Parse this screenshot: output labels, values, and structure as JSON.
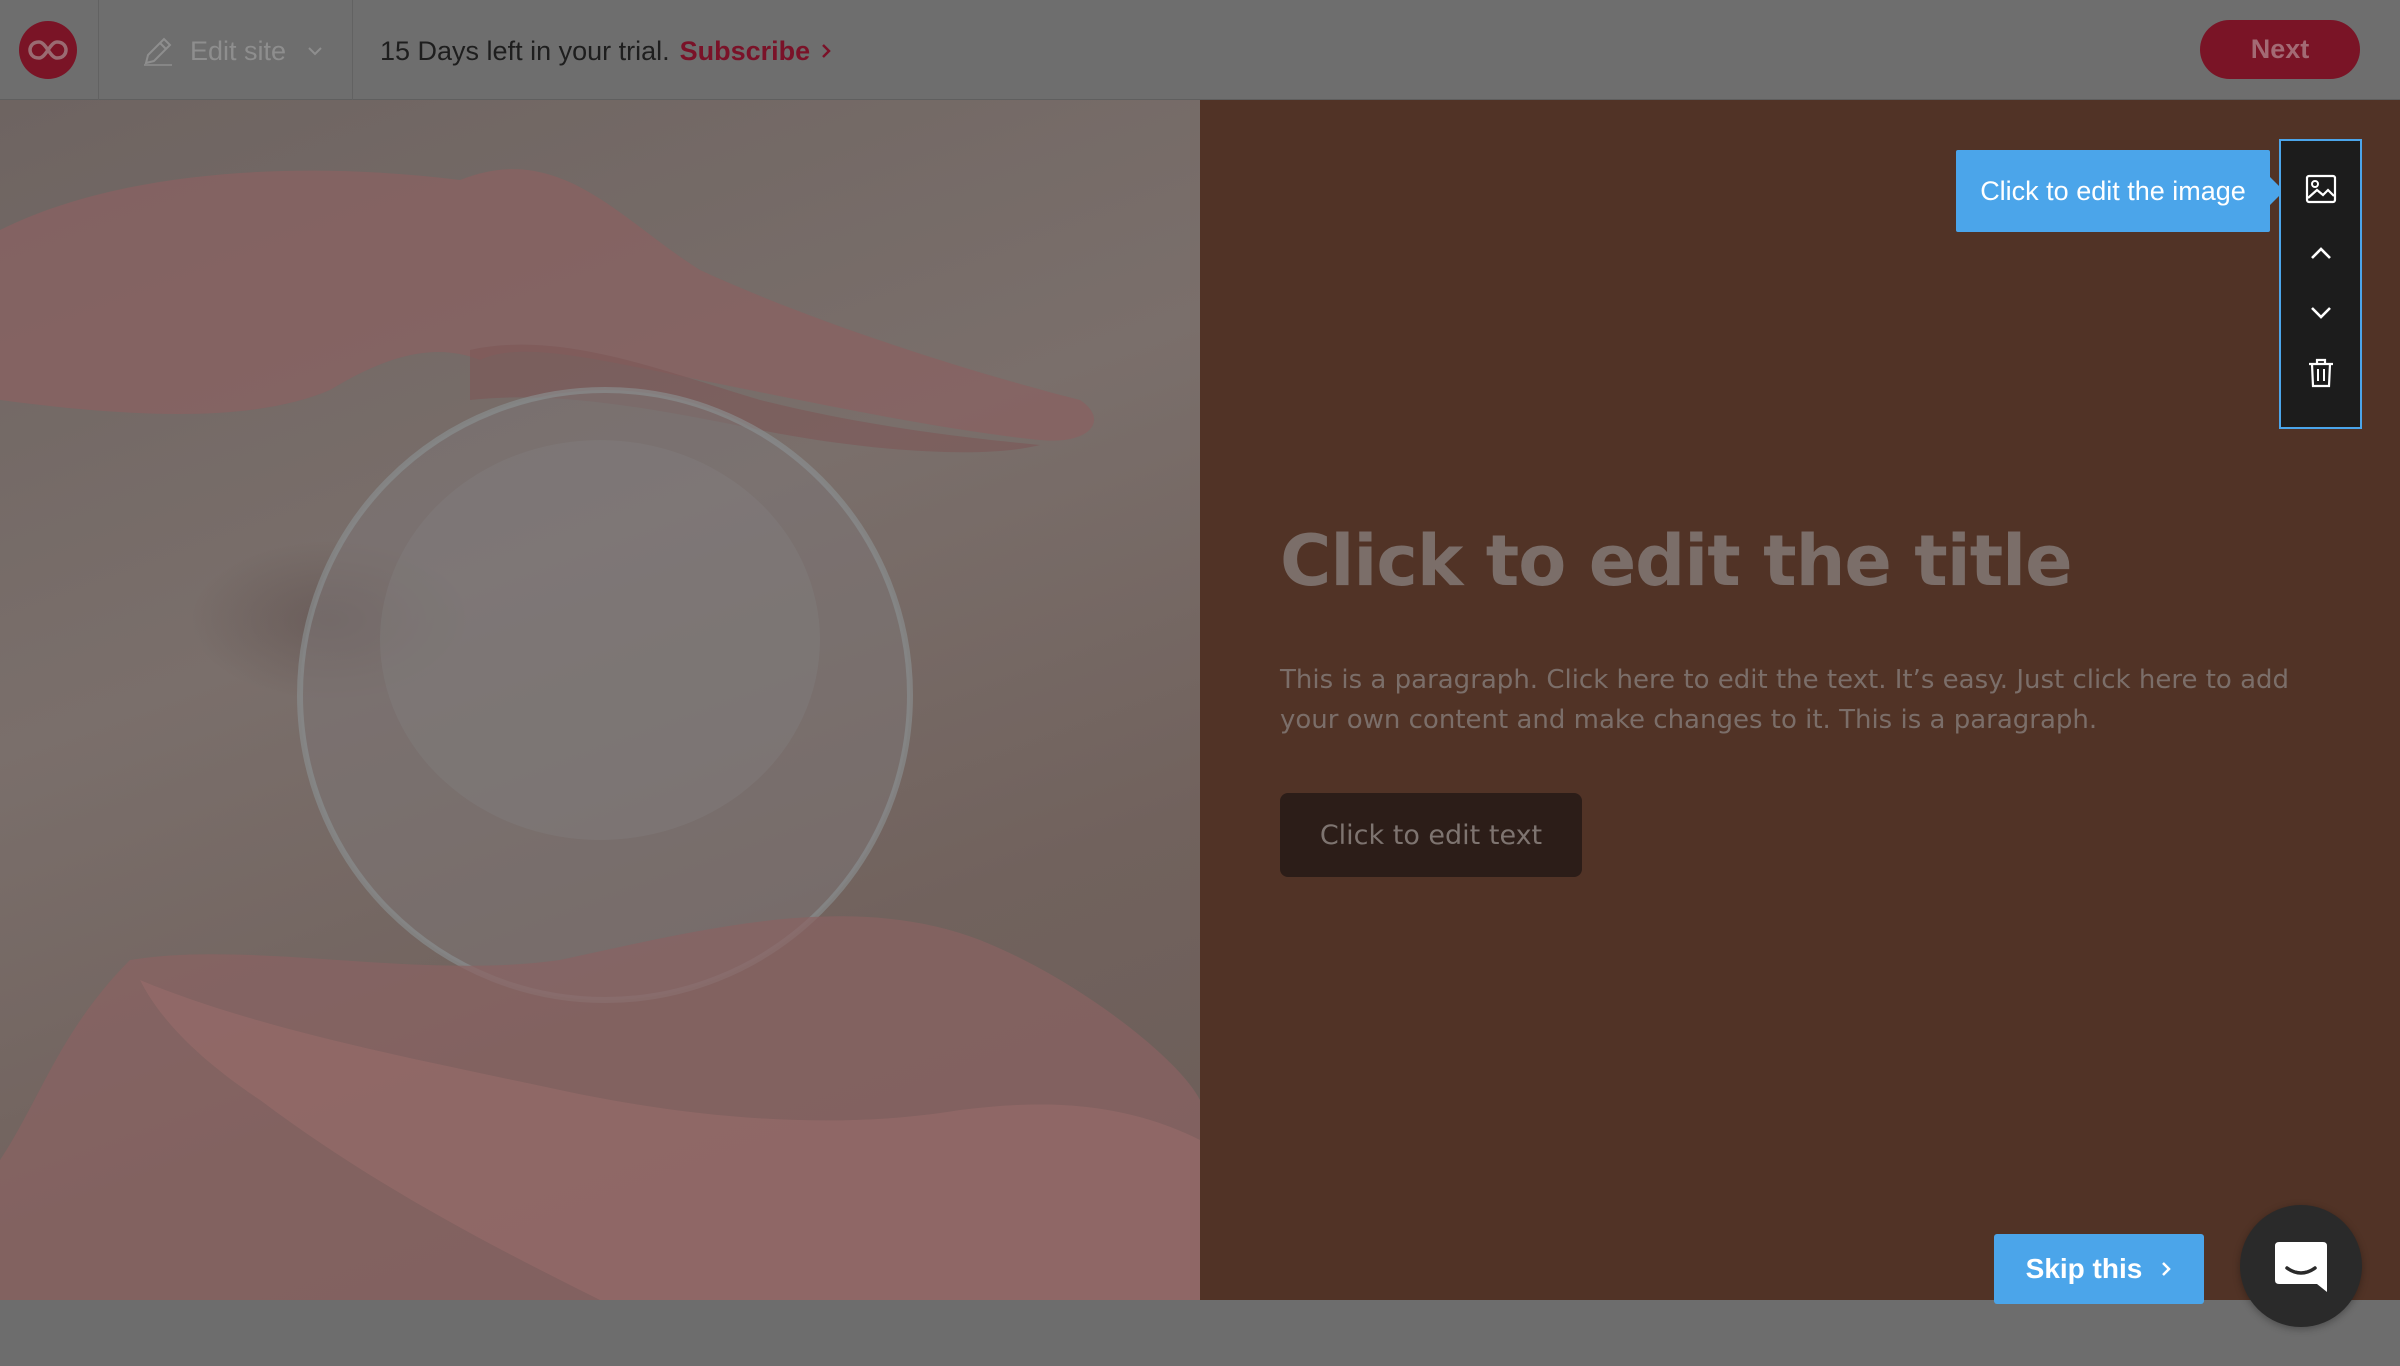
{
  "topbar": {
    "logo_icon": "infinity-logo-icon",
    "edit_site_label": "Edit site",
    "trial_text": "15 Days left in your trial.",
    "subscribe_label": "Subscribe",
    "next_label": "Next"
  },
  "content": {
    "title": "Click to edit the title",
    "paragraph": "This is a paragraph. Click here to edit the text. It’s easy. Just click here to add your own content and make changes to it. This is a paragraph.",
    "button_label": "Click to edit text"
  },
  "tools": {
    "tooltip": "Click to edit the image",
    "items": [
      "image-icon",
      "chevron-up-icon",
      "chevron-down-icon",
      "trash-icon"
    ]
  },
  "footer": {
    "skip_label": "Skip this"
  },
  "colors": {
    "brand": "#7a1426",
    "accent": "#4ba5ea",
    "panel": "#513326"
  }
}
